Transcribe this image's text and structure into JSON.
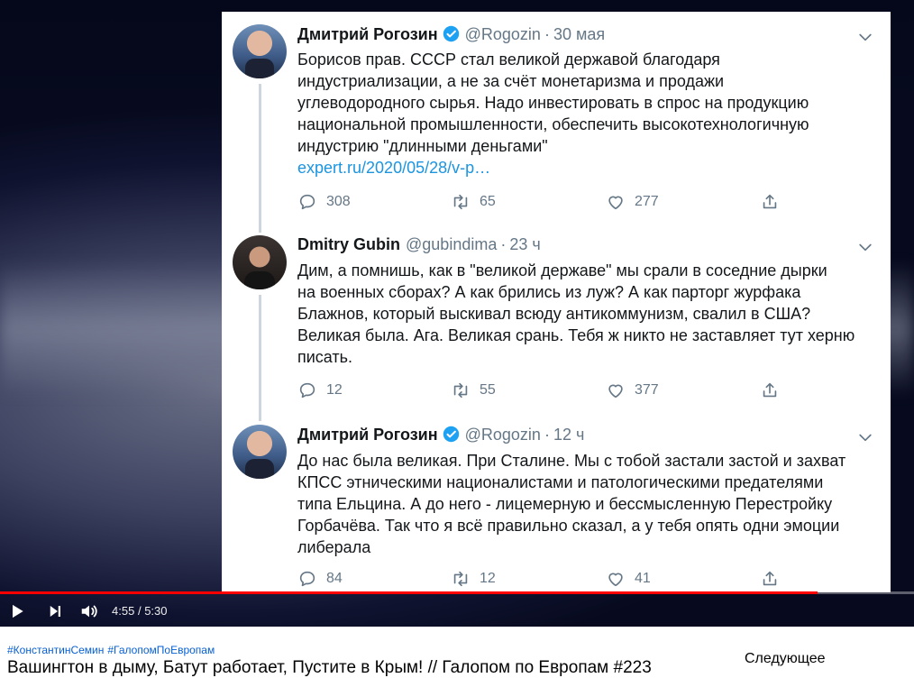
{
  "tweets": [
    {
      "author": "Дмитрий Рогозин",
      "verified": true,
      "handle": "@Rogozin",
      "time": "30 мая",
      "lines": [
        "Борисов прав. СССР стал великой державой благодаря",
        "индустриализации, а не за счёт монетаризма и продажи",
        "углеводородного сырья. Надо инвестировать в спрос на продукцию",
        "национальной промышленности, обеспечить высокотехнологичную",
        "индустрию \"длинными деньгами\""
      ],
      "link": "expert.ru/2020/05/28/v-p…",
      "replies": "308",
      "retweets": "65",
      "likes": "277"
    },
    {
      "author": "Dmitry Gubin",
      "verified": false,
      "handle": "@gubindima",
      "time": "23 ч",
      "lines": [
        "Дим, а помнишь, как в \"великой державе\" мы срали в соседние дырки",
        "на военных сборах? А как брились из луж? А как парторг журфака",
        "Блажнов, который выскивал всюду антикоммунизм, свалил в США?",
        "Великая была. Ага. Великая срань. Тебя ж никто не заставляет тут херню",
        "писать."
      ],
      "replies": "12",
      "retweets": "55",
      "likes": "377"
    },
    {
      "author": "Дмитрий Рогозин",
      "verified": true,
      "handle": "@Rogozin",
      "time": "12 ч",
      "lines": [
        "До нас была великая. При Сталине. Мы с тобой застали застой и захват",
        "КПСС этническими националистами и патологическими предателями",
        "типа Ельцина. А до него - лицемерную и бессмысленную Перестройку",
        "Горбачёва. Так что я всё правильно сказал, а у тебя опять одни эмоции",
        "либерала"
      ],
      "replies": "84",
      "retweets": "12",
      "likes": "41"
    }
  ],
  "player": {
    "current_time": "4:55",
    "separator": "/",
    "duration": "5:30",
    "progress_fraction": 0.894
  },
  "video": {
    "hashtags": [
      "#КонстантинСемин",
      "#ГалопомПоЕвропам"
    ],
    "title": "Вашингтон в дыму, Батут работает, Пустите в Крым! // Галопом по Европам #223"
  },
  "up_next_label": "Следующее",
  "colors": {
    "progress": "#ff0000",
    "link": "#1b95e0",
    "verified": "#1da1f2",
    "hashtag": "#065fd4"
  },
  "icons": {
    "reply": "reply-icon",
    "retweet": "retweet-icon",
    "like": "heart-icon",
    "share": "share-icon",
    "more": "chevron-down-icon",
    "play": "play-icon",
    "next": "next-icon",
    "volume": "volume-icon"
  }
}
